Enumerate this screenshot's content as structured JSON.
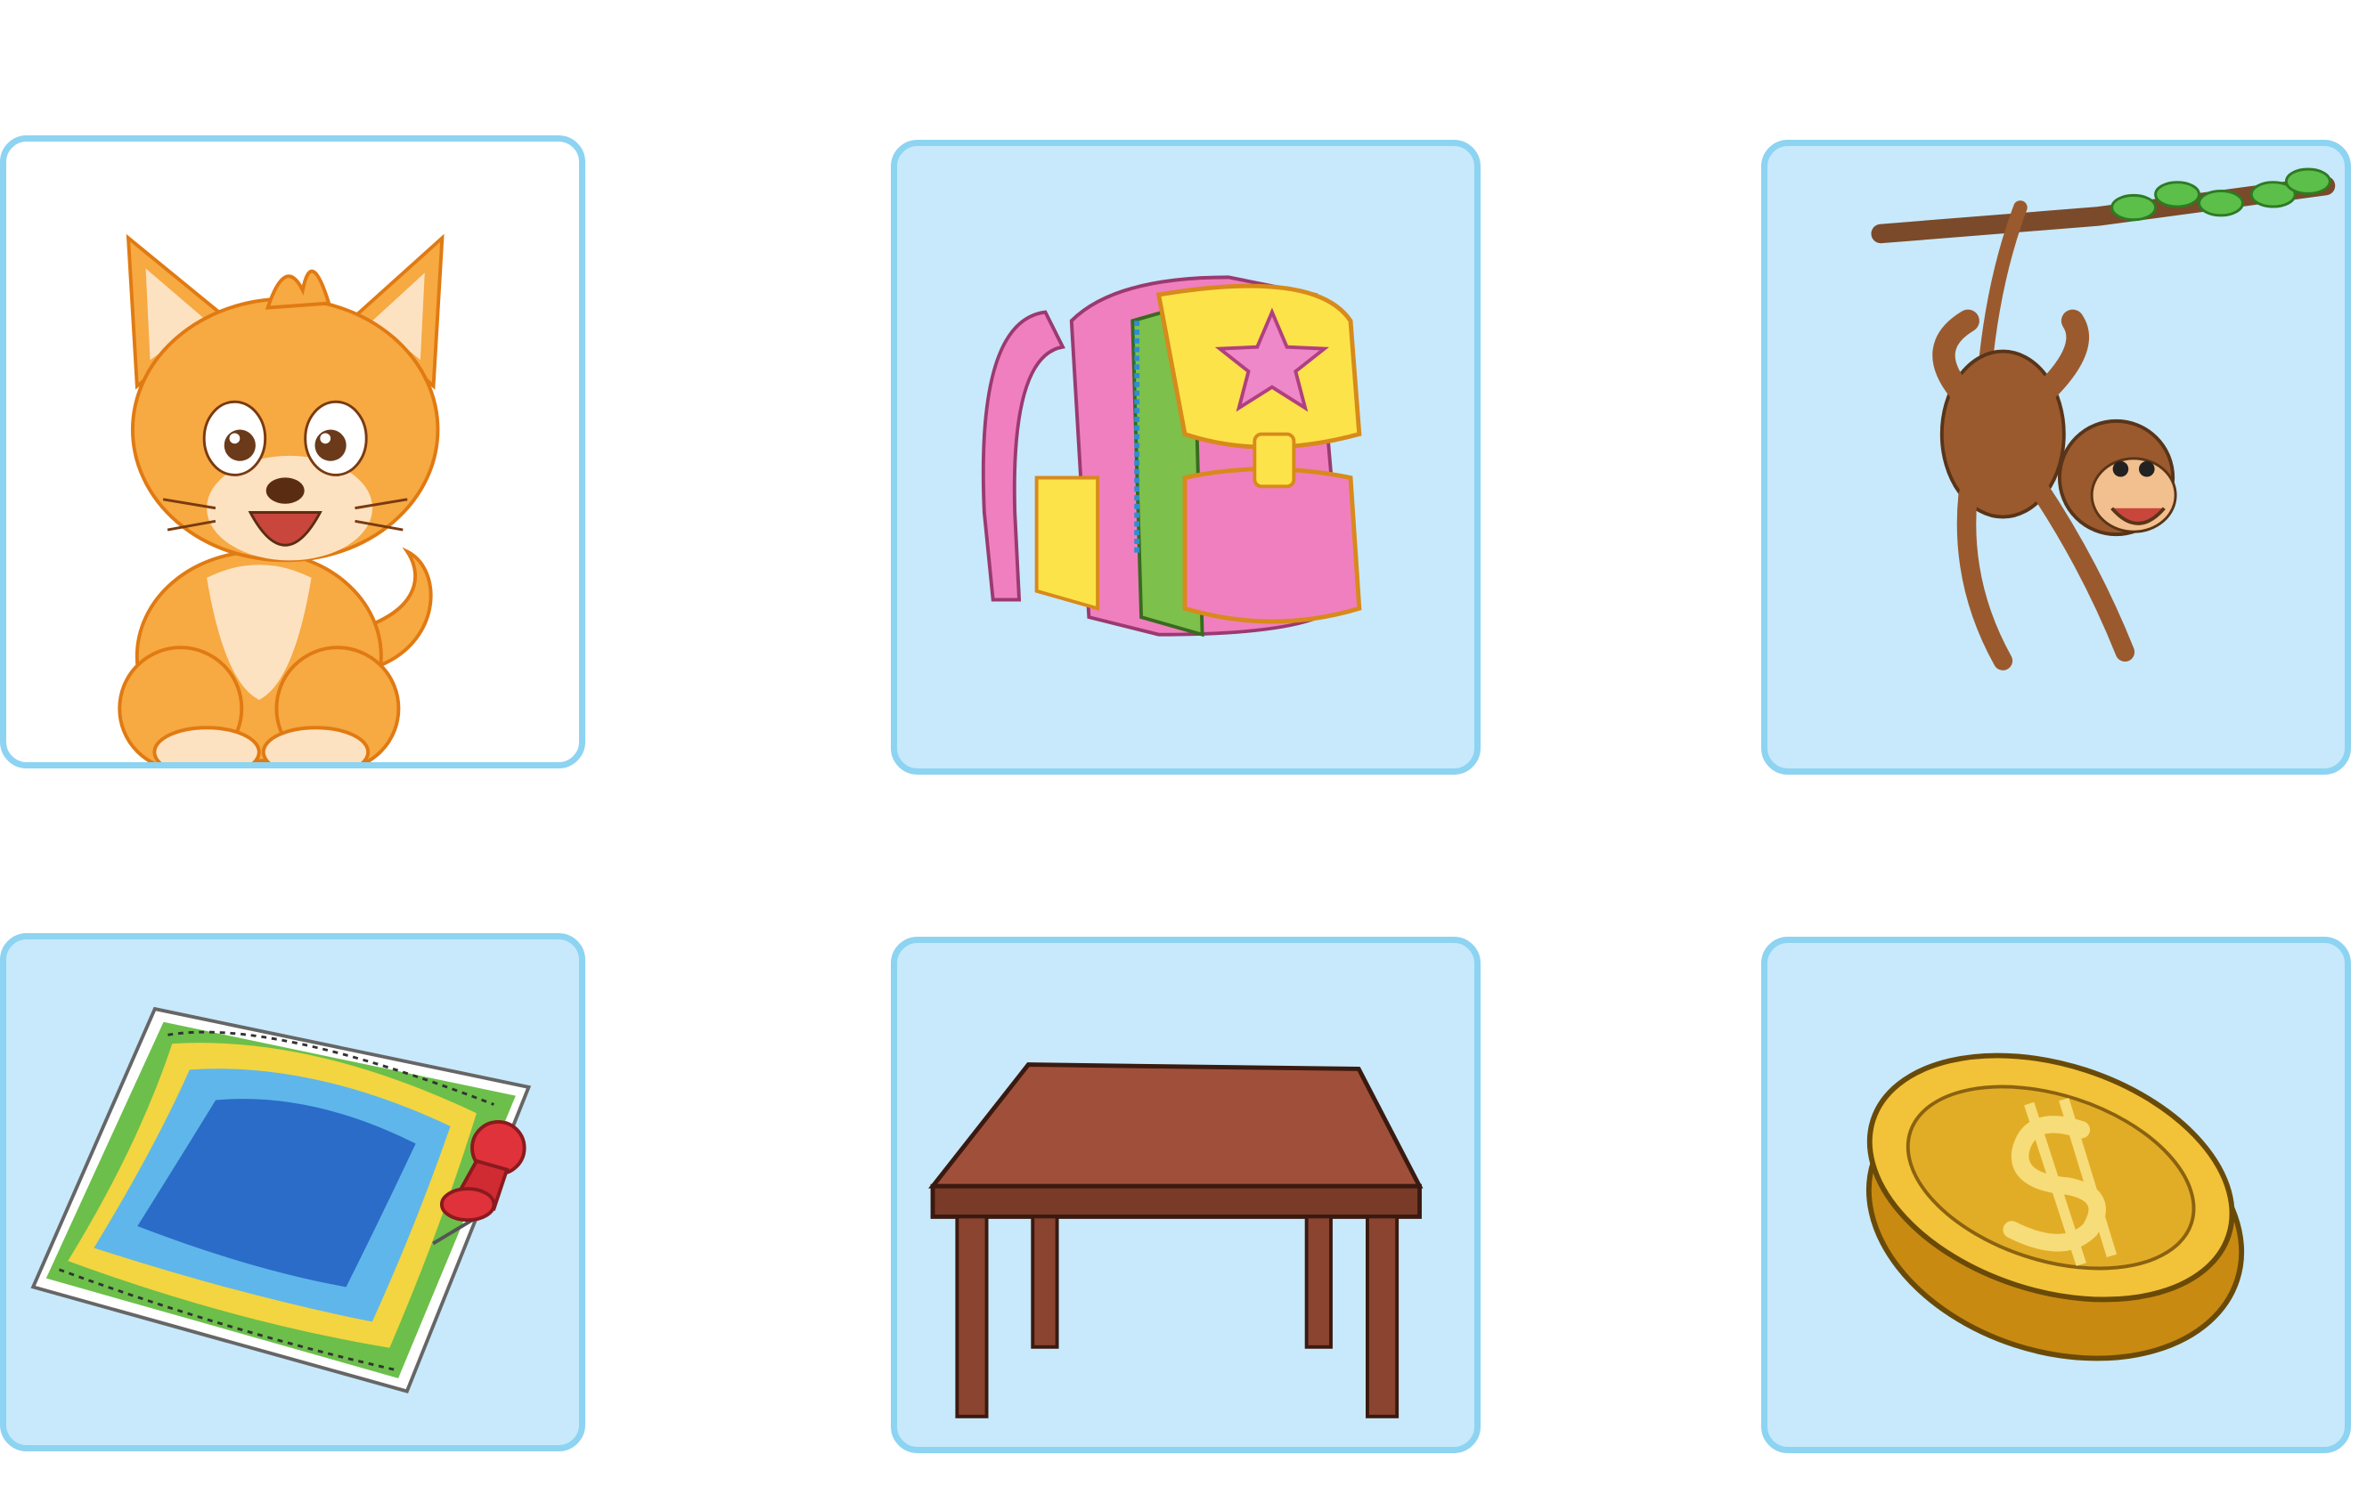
{
  "board": {
    "cards": [
      {
        "id": "card-1",
        "picture": "kitten",
        "selected": true
      },
      {
        "id": "card-2",
        "picture": "backpack",
        "selected": false
      },
      {
        "id": "card-3",
        "picture": "monkey",
        "selected": false
      },
      {
        "id": "card-4",
        "picture": "map",
        "selected": false
      },
      {
        "id": "card-5",
        "picture": "table",
        "selected": false
      },
      {
        "id": "card-6",
        "picture": "coin",
        "selected": false
      }
    ]
  },
  "colors": {
    "card_fill": "#c7e9fb",
    "card_border": "#8dd3f2",
    "selected_card_fill": "#ffffff",
    "page_background": "#ffffff"
  }
}
